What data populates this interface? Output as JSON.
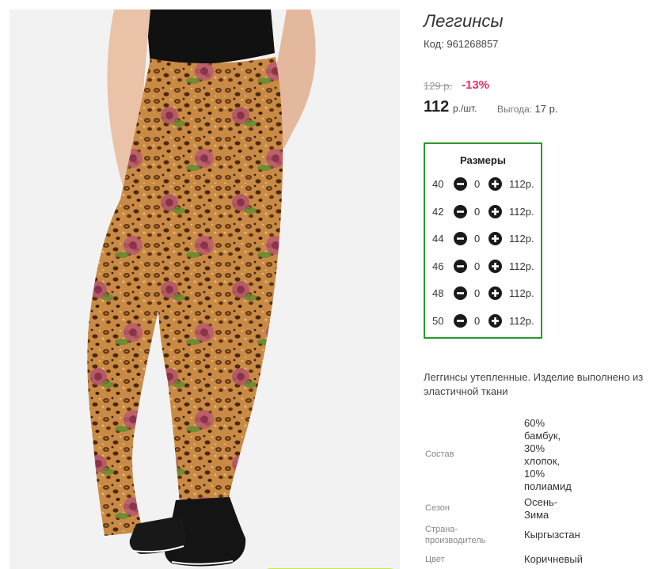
{
  "product": {
    "title": "Леггинсы",
    "code_label": "Код:",
    "code": "961268857",
    "old_price": "129 р.",
    "discount": "-13%",
    "price": "112",
    "price_unit": "р./шт.",
    "saving_label": "Выгода:",
    "saving_value": "17 р."
  },
  "sizes": {
    "title": "Размеры",
    "rows": [
      {
        "size": "40",
        "qty": "0",
        "price": "112р."
      },
      {
        "size": "42",
        "qty": "0",
        "price": "112р."
      },
      {
        "size": "44",
        "qty": "0",
        "price": "112р."
      },
      {
        "size": "46",
        "qty": "0",
        "price": "112р."
      },
      {
        "size": "48",
        "qty": "0",
        "price": "112р."
      },
      {
        "size": "50",
        "qty": "0",
        "price": "112р."
      }
    ]
  },
  "description": "Леггинсы утепленные. Изделие выполнено из эластичной ткани",
  "properties": {
    "composition_label": "Состав",
    "composition_value": "60% бамбук, 30% хлопок, 10% полиамид",
    "season_label": "Сезон",
    "season_value": "Осень-Зима",
    "country_label": "Страна-производитель",
    "country_value": "Кыргызстан",
    "color_label": "Цвет",
    "color_value": "Коричневый"
  },
  "icons": {
    "minus": "minus-circle-icon",
    "plus": "plus-circle-icon"
  },
  "colors": {
    "discount": "#e0306a",
    "sizes_border": "#2a9a2a",
    "cart_button": "#c7e84a"
  }
}
